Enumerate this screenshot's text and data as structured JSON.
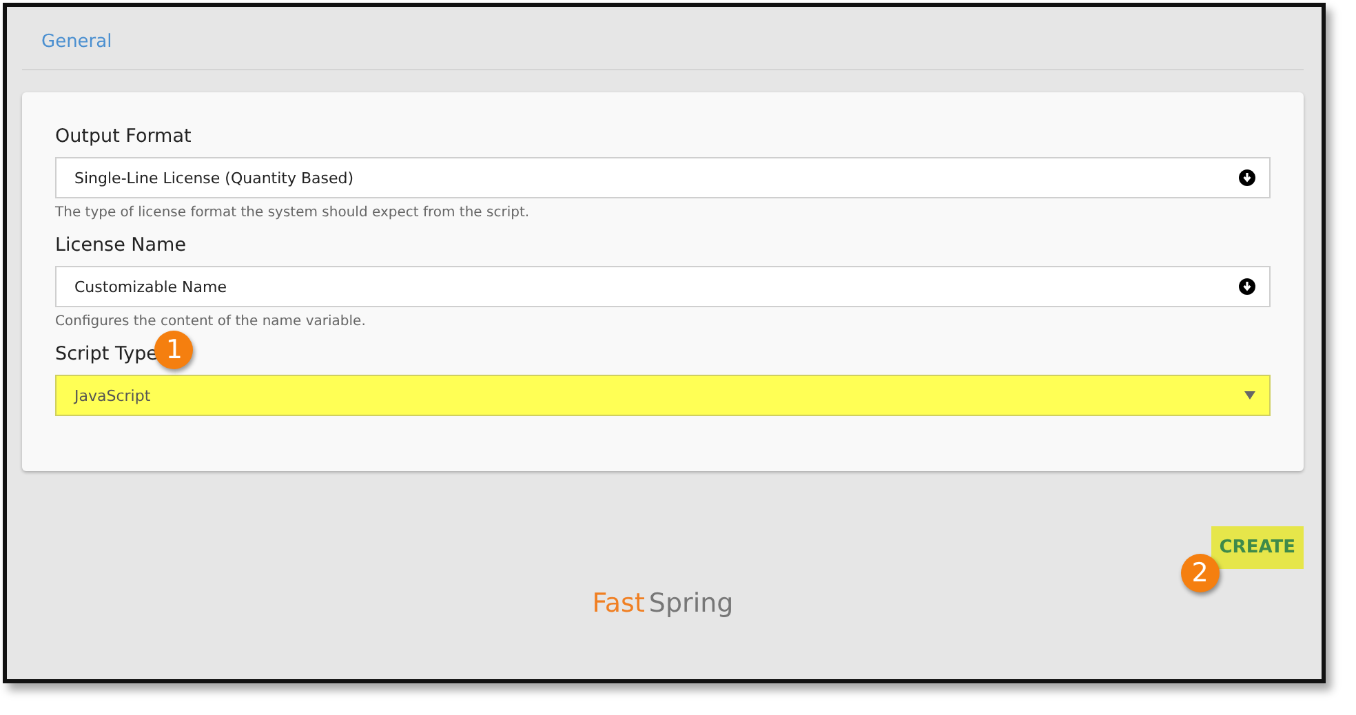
{
  "tab": {
    "label": "General"
  },
  "fields": [
    {
      "label": "Output Format",
      "value": "Single-Line License (Quantity Based)",
      "help": "The type of license format the system should expect from the script.",
      "kind": "select",
      "highlighted": false
    },
    {
      "label": "License Name",
      "value": "Customizable Name",
      "help": "Configures the content of the name variable.",
      "kind": "select",
      "highlighted": false
    },
    {
      "label": "Script Type",
      "value": "JavaScript",
      "kind": "dropdown",
      "highlighted": true,
      "callout": "1"
    }
  ],
  "create_button": {
    "label": "CREATE",
    "highlighted": true,
    "callout": "2"
  },
  "logo": {
    "first": "Fast",
    "second": "Spring"
  }
}
